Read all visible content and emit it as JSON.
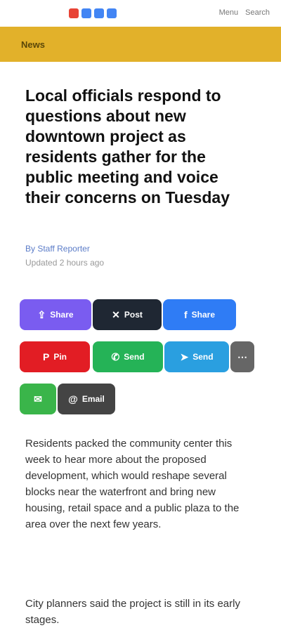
{
  "site": {
    "logo_colors": [
      "#e84335",
      "#4285f4",
      "#4285f4",
      "#4285f4"
    ],
    "nav": [
      "Menu",
      "Search"
    ]
  },
  "banner": {
    "label": "News",
    "color": "#e2b12a"
  },
  "article": {
    "headline": "Local officials respond to questions about new downtown project as residents gather for the public meeting and voice their concerns on Tuesday",
    "byline": "By Staff Reporter",
    "date": "Updated 2 hours ago",
    "paragraphs": [
      "Residents packed the community center this week to hear more about the proposed development, which would reshape several blocks near the waterfront and bring new housing, retail space and a public plaza to the area over the next few years.",
      "City planners said the project is still in its early stages."
    ]
  },
  "share": {
    "buttons": [
      {
        "label": "Share",
        "color": "#7a5cf0",
        "icon": "share-icon"
      },
      {
        "label": "Post",
        "color": "#1f2733",
        "icon": "x-icon"
      },
      {
        "label": "Share",
        "color": "#2f7cf5",
        "icon": "facebook-icon"
      },
      {
        "label": "Pin",
        "color": "#e21d24",
        "icon": "pinterest-icon"
      },
      {
        "label": "Send",
        "color": "#25b357",
        "icon": "whatsapp-icon"
      },
      {
        "label": "Send",
        "color": "#2a9fe0",
        "icon": "telegram-icon"
      },
      {
        "label": "",
        "color": "#666666",
        "icon": "more-icon"
      },
      {
        "label": "",
        "color": "#3ab54a",
        "icon": "sms-icon"
      },
      {
        "label": "Email",
        "color": "#444444",
        "icon": "email-icon"
      }
    ]
  }
}
